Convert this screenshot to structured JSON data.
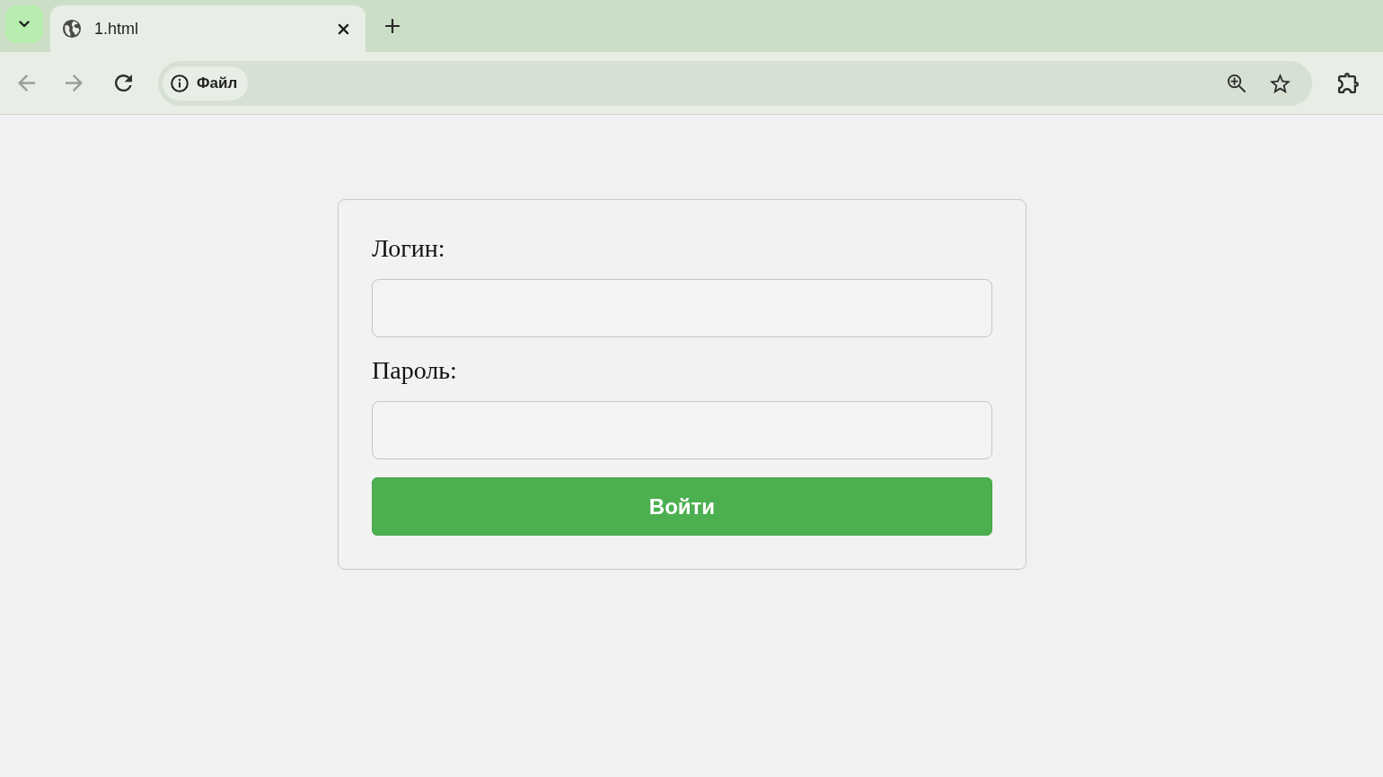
{
  "browser": {
    "tabs": [
      {
        "title": "1.html",
        "selected": true
      }
    ],
    "toolbar": {
      "back": {
        "disabled": true
      },
      "forward": {
        "disabled": true
      }
    },
    "address_bar": {
      "site_info": "Файл"
    }
  },
  "login_form": {
    "fields": [
      {
        "label": "Логин:"
      },
      {
        "label": "Пароль:"
      }
    ],
    "submit_button": "Войти"
  }
}
